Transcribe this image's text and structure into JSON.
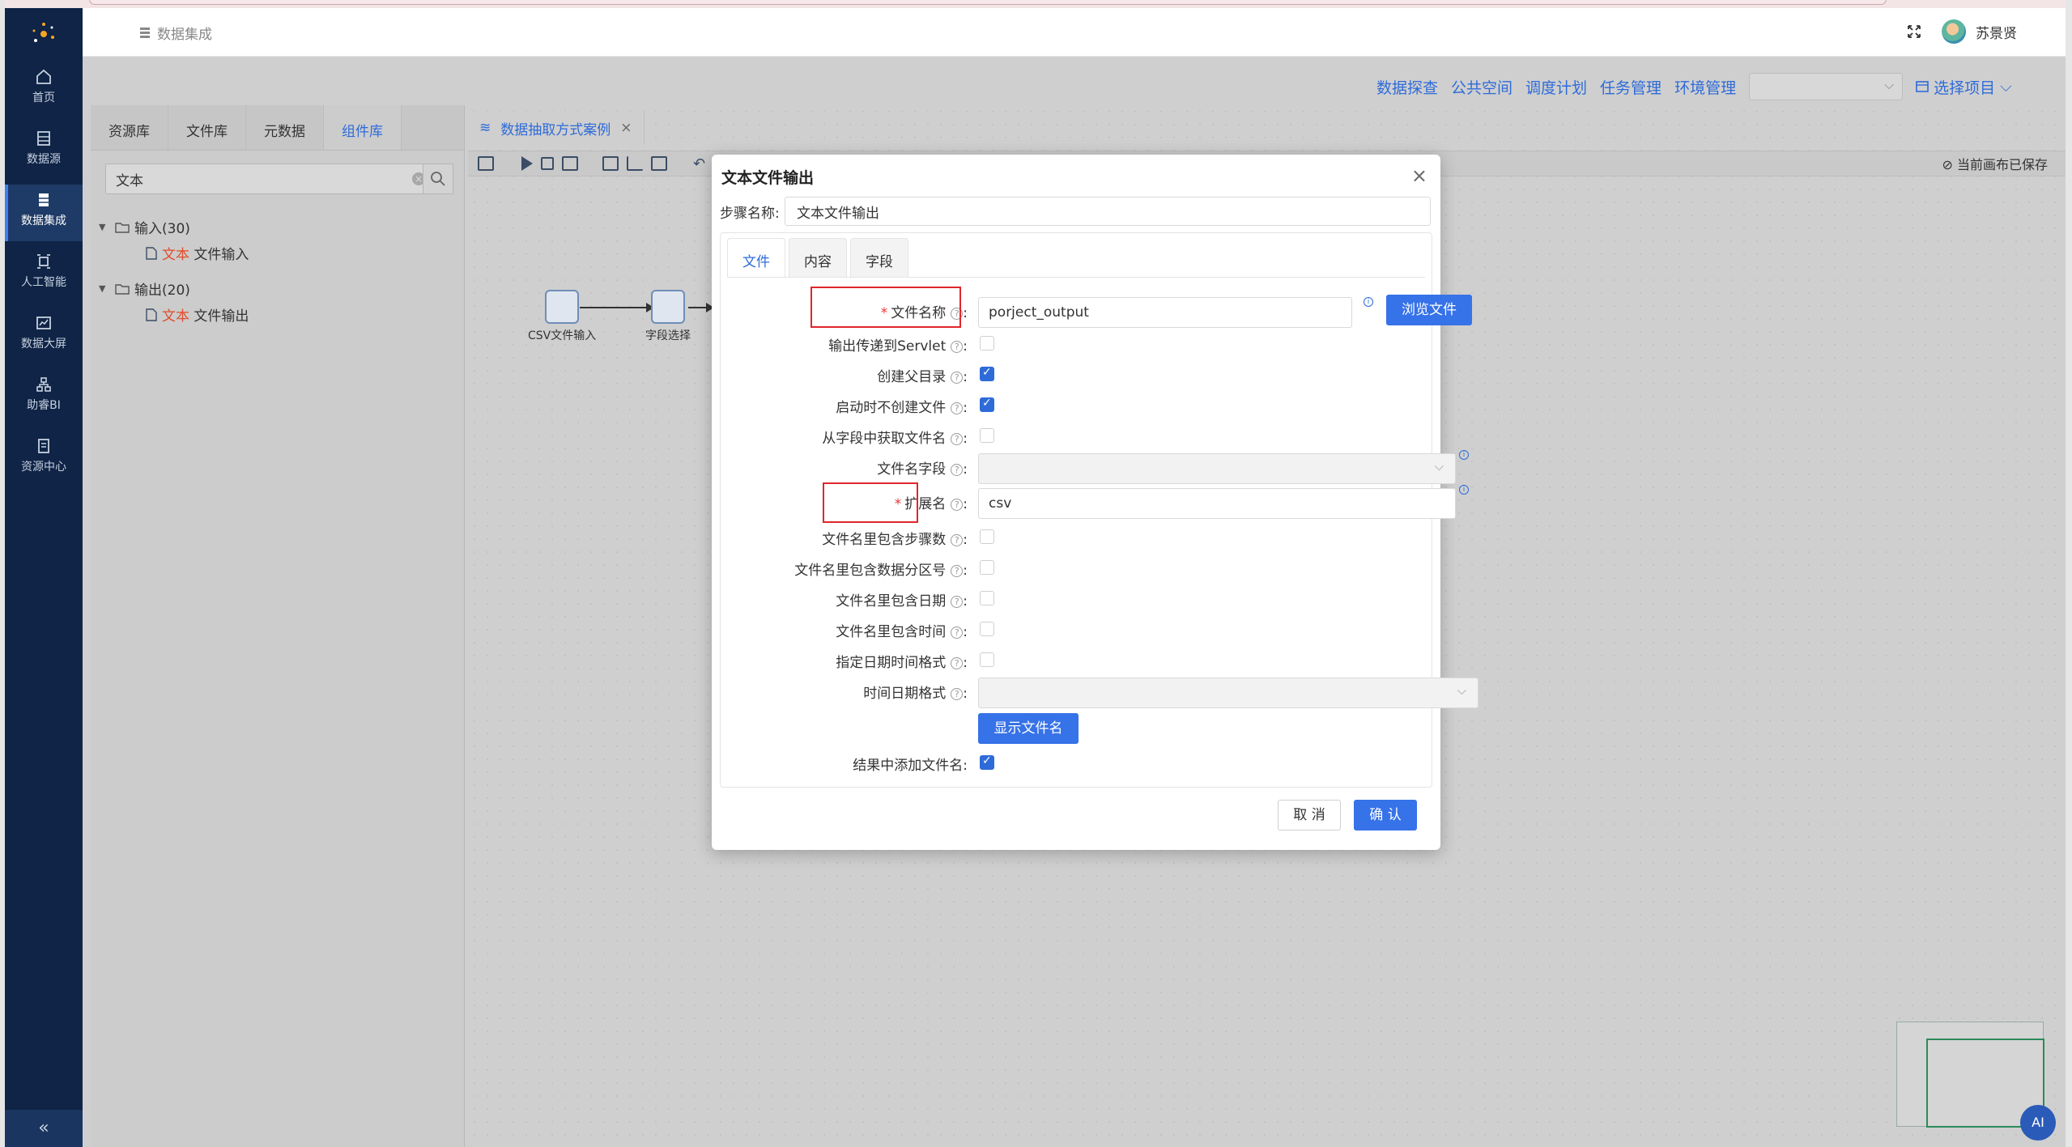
{
  "header": {
    "breadcrumb": "数据集成",
    "user_name": "苏景贤"
  },
  "sidebar": {
    "items": [
      {
        "label": "首页",
        "icon": "home-icon"
      },
      {
        "label": "数据源",
        "icon": "database-icon"
      },
      {
        "label": "数据集成",
        "icon": "integration-icon"
      },
      {
        "label": "人工智能",
        "icon": "ai-icon"
      },
      {
        "label": "数据大屏",
        "icon": "chart-icon"
      },
      {
        "label": "助睿BI",
        "icon": "bi-icon"
      },
      {
        "label": "资源中心",
        "icon": "resource-icon"
      }
    ],
    "active": "数据集成"
  },
  "topnav": {
    "links": [
      "数据探查",
      "公共空间",
      "调度计划",
      "任务管理",
      "环境管理"
    ],
    "project_label": "选择项目"
  },
  "left_panel": {
    "tabs": [
      "资源库",
      "文件库",
      "元数据",
      "组件库"
    ],
    "active_tab": "组件库",
    "search_value": "文本",
    "tree": [
      {
        "folder": "输入",
        "count": "(30)",
        "child_hl": "文本",
        "child_rest": " 文件输入"
      },
      {
        "folder": "输出",
        "count": "(20)",
        "child_hl": "文本",
        "child_rest": " 文件输出"
      }
    ]
  },
  "flow": {
    "tab_label": "数据抽取方式案例",
    "saved_status": "当前画布已保存",
    "nodes": [
      "CSV文件输入",
      "字段选择"
    ]
  },
  "modal": {
    "title": "文本文件输出",
    "step_name_label": "步骤名称:",
    "step_name_value": "文本文件输出",
    "tabs": [
      "文件",
      "内容",
      "字段"
    ],
    "active_tab": "文件",
    "fields": {
      "filename_label": "文件名称",
      "filename_value": "porject_output",
      "browse_button": "浏览文件",
      "servlet_label": "输出传递到Servlet",
      "create_parent_label": "创建父目录",
      "no_create_on_start_label": "启动时不创建文件",
      "get_name_from_field_label": "从字段中获取文件名",
      "filename_field_label": "文件名字段",
      "extension_label": "扩展名",
      "extension_value": "csv",
      "include_stepnr_label": "文件名里包含步骤数",
      "include_partition_label": "文件名里包含数据分区号",
      "include_date_label": "文件名里包含日期",
      "include_time_label": "文件名里包含时间",
      "specify_format_label": "指定日期时间格式",
      "date_format_label": "时间日期格式",
      "show_filename_button": "显示文件名",
      "add_to_result_label": "结果中添加文件名"
    },
    "checks": {
      "servlet": false,
      "create_parent": true,
      "no_create_on_start": true,
      "get_name_from_field": false,
      "include_stepnr": false,
      "include_partition": false,
      "include_date": false,
      "include_time": false,
      "specify_format": false,
      "add_to_result": true
    },
    "cancel_button": "取 消",
    "confirm_button": "确 认"
  },
  "ai_button": "AI",
  "colors": {
    "primary": "#3672e8",
    "sidebar": "#0f2446",
    "highlight_box": "#e0262c"
  }
}
